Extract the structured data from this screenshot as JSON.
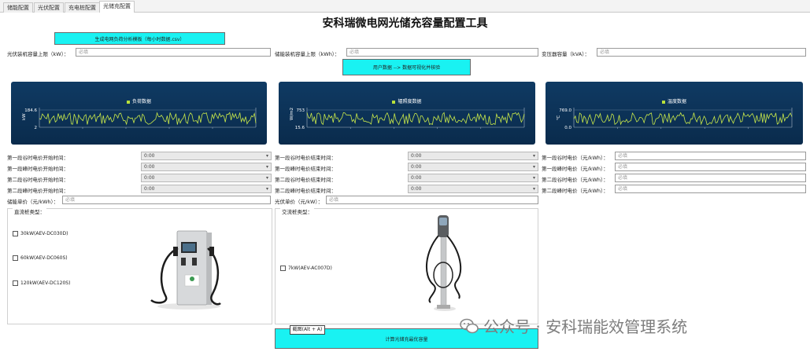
{
  "tabs": [
    {
      "label": "储能配置"
    },
    {
      "label": "光伏配置"
    },
    {
      "label": "充电桩配置"
    },
    {
      "label": "光储充配置"
    }
  ],
  "title": "安科瑞微电网光储充容量配置工具",
  "buttons": {
    "generate_template": "生成电网负荷分析模板（每小时数据.csv）",
    "visualize": "用户数据 --> 数据可视化并核验",
    "calculate": "计算光储充最优容量"
  },
  "capacity_inputs": {
    "pv_label": "光伏装机容量上限（kW）：",
    "pv_placeholder": "必填",
    "storage_label": "储能装机容量上限（kWh）：",
    "storage_placeholder": "必填",
    "transformer_label": "变压器容量（kVA）：",
    "transformer_placeholder": "必填"
  },
  "charts": [
    {
      "legend": "负荷数据",
      "y_unit": "kW",
      "ymax": "184.6",
      "ymin": "2",
      "color": "#c9e84a"
    },
    {
      "legend": "辐照度数据",
      "y_unit": "W/m2",
      "ymax": "753",
      "ymin": "15.6",
      "color": "#c9e84a"
    },
    {
      "legend": "温度数据",
      "y_unit": "℃",
      "ymax": "769.0",
      "ymin": "0.0",
      "color": "#c9e84a"
    }
  ],
  "time_fields": {
    "col1": [
      {
        "label": "第一段谷时电价开始时间：",
        "value": "0:00"
      },
      {
        "label": "第一段峰时电价开始时间：",
        "value": "0:00"
      },
      {
        "label": "第二段谷时电价开始时间：",
        "value": "0:00"
      },
      {
        "label": "第二段峰时电价开始时间：",
        "value": "0:00"
      }
    ],
    "col2": [
      {
        "label": "第一段谷时电价结束时间：",
        "value": "0:00"
      },
      {
        "label": "第一段峰时电价结束时间：",
        "value": "0:00"
      },
      {
        "label": "第二段谷时电价结束时间：",
        "value": "0:00"
      },
      {
        "label": "第二段峰时电价结束时间：",
        "value": "0:00"
      }
    ],
    "col3": [
      {
        "label": "第一段谷时电价（元/kWh）：",
        "placeholder": "必填"
      },
      {
        "label": "第一段峰时电价（元/kWh）：",
        "placeholder": "必填"
      },
      {
        "label": "第二段谷时电价（元/kWh）：",
        "placeholder": "必填"
      },
      {
        "label": "第二段峰时电价（元/kWh）：",
        "placeholder": "必填"
      }
    ]
  },
  "unit_price": {
    "storage_label": "储能单价（元/kWh）：",
    "storage_placeholder": "必填",
    "pv_label": "光伏单价（元/kW）：",
    "pv_placeholder": "必填"
  },
  "dc_group": {
    "title": "直流桩类型：",
    "options": [
      "30kW(AEV-DC030D)",
      "60kW(AEV-DC060S)",
      "120kW(AEV-DC120S)"
    ]
  },
  "ac_group": {
    "title": "交流桩类型：",
    "options": [
      "7kW(AEV-AC007D)"
    ]
  },
  "tooltip": "截图(Alt + A)",
  "watermark": "公众号 · 安科瑞能效管理系统"
}
